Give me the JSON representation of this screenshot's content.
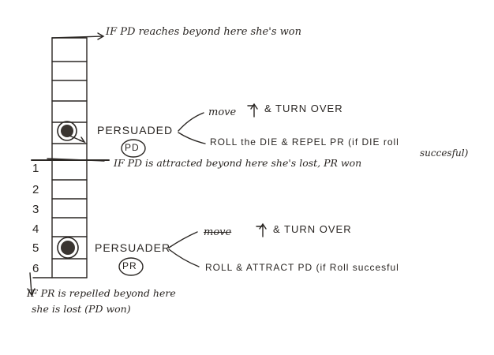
{
  "top_note": "IF PD reaches beyond here she's won",
  "middle_note": "IF PD is attracted beyond here she's lost, PR won",
  "bottom_note_line1": "IF PR is repelled beyond here",
  "bottom_note_line2": "she is lost (PD won)",
  "persuaded": {
    "label": "PERSUADED",
    "abbr": "PD",
    "option1_move": "move",
    "option1_rest": "& TURN OVER",
    "option2_line1": "ROLL the DIE & REPEL PR (if DIE roll",
    "option2_line2": "succesful)"
  },
  "persuader": {
    "label": "PERSUADER",
    "abbr": "PR",
    "option1_move": "move",
    "option1_rest": "& TURN OVER",
    "option2": "ROLL & ATTRACT PD (if Roll succesful"
  },
  "numbers": [
    "1",
    "2",
    "3",
    "4",
    "5",
    "6"
  ],
  "ink_color": "#2a2623"
}
